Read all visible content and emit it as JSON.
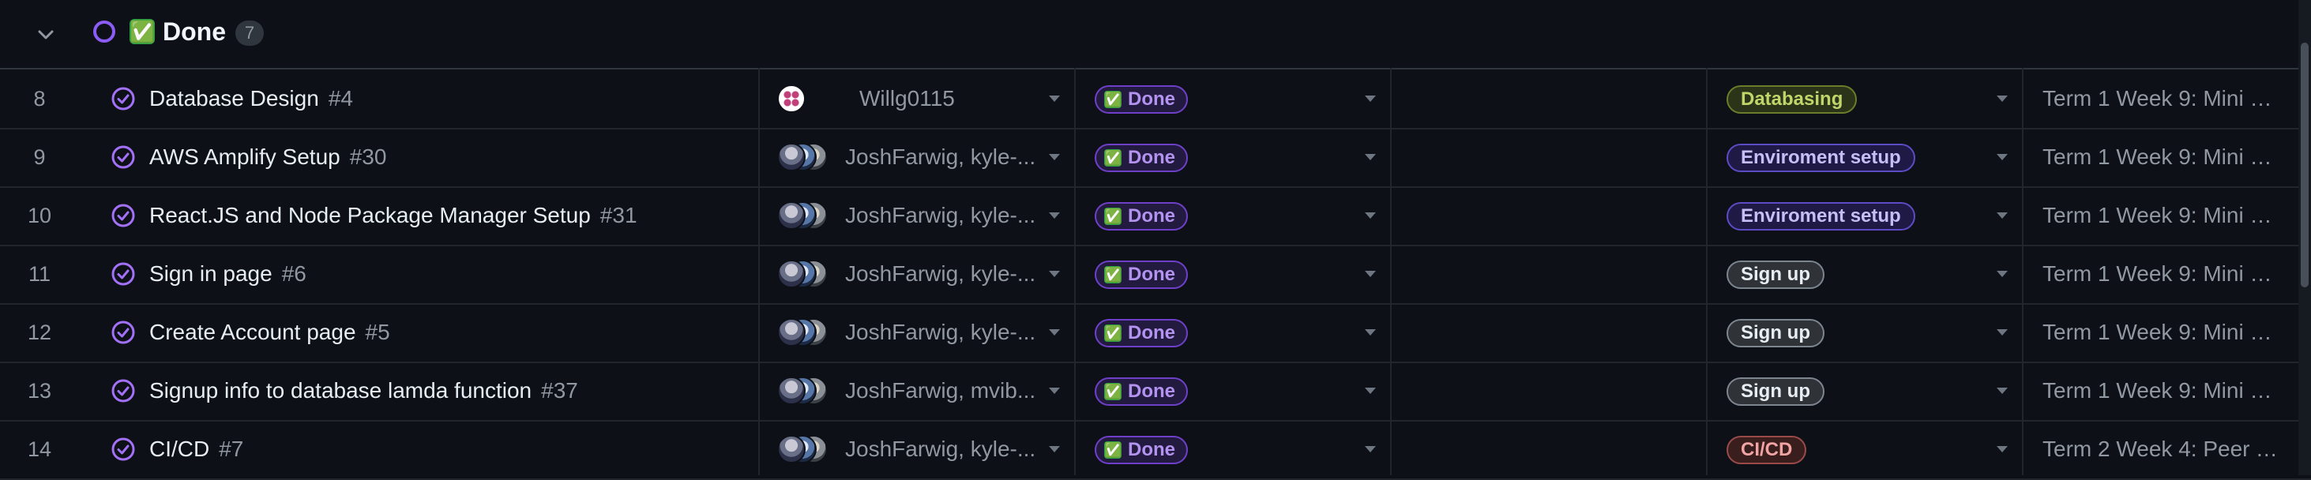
{
  "group": {
    "title": "Done",
    "emoji": "✅",
    "count": "7"
  },
  "rows": [
    {
      "num": "8",
      "title": "Database Design",
      "issue": "#4",
      "assignees": "Willg0115",
      "avatar_style": "single",
      "status": "Done",
      "label": "Databasing",
      "label_style": "databasing",
      "iteration": "Term 1 Week 9: Mini Pre..."
    },
    {
      "num": "9",
      "title": "AWS Amplify Setup",
      "issue": "#30",
      "assignees": "JoshFarwig, kyle-...",
      "avatar_style": "stack",
      "status": "Done",
      "label": "Enviroment setup",
      "label_style": "env",
      "iteration": "Term 1 Week 9: Mini Pre..."
    },
    {
      "num": "10",
      "title": "React.JS and Node Package Manager Setup",
      "issue": "#31",
      "assignees": "JoshFarwig, kyle-...",
      "avatar_style": "stack",
      "status": "Done",
      "label": "Enviroment setup",
      "label_style": "env",
      "iteration": "Term 1 Week 9: Mini Pre..."
    },
    {
      "num": "11",
      "title": "Sign in page",
      "issue": "#6",
      "assignees": "JoshFarwig, kyle-...",
      "avatar_style": "stack",
      "status": "Done",
      "label": "Sign up",
      "label_style": "signup",
      "iteration": "Term 1 Week 9: Mini Pre..."
    },
    {
      "num": "12",
      "title": "Create Account page",
      "issue": "#5",
      "assignees": "JoshFarwig, kyle-...",
      "avatar_style": "stack",
      "status": "Done",
      "label": "Sign up",
      "label_style": "signup",
      "iteration": "Term 1 Week 9: Mini Pre..."
    },
    {
      "num": "13",
      "title": "Signup info to database lamda function",
      "issue": "#37",
      "assignees": "JoshFarwig, mvib...",
      "avatar_style": "stack2",
      "status": "Done",
      "label": "Sign up",
      "label_style": "signup",
      "iteration": "Term 1 Week 9: Mini Pre..."
    },
    {
      "num": "14",
      "title": "CI/CD",
      "issue": "#7",
      "assignees": "JoshFarwig, kyle-...",
      "avatar_style": "stack",
      "status": "Done",
      "label": "CI/CD",
      "label_style": "cicd",
      "iteration": "Term 2 Week 4: Peer Te..."
    }
  ],
  "colors": {
    "background": "#0d1117",
    "done_purple": "#8b5cf6",
    "check_green": "#2ea043"
  },
  "icons": {
    "collapse": "chevron-down-icon",
    "group_status": "circle-icon",
    "row_status": "circle-check-icon",
    "dropdown": "caret-down-icon"
  }
}
